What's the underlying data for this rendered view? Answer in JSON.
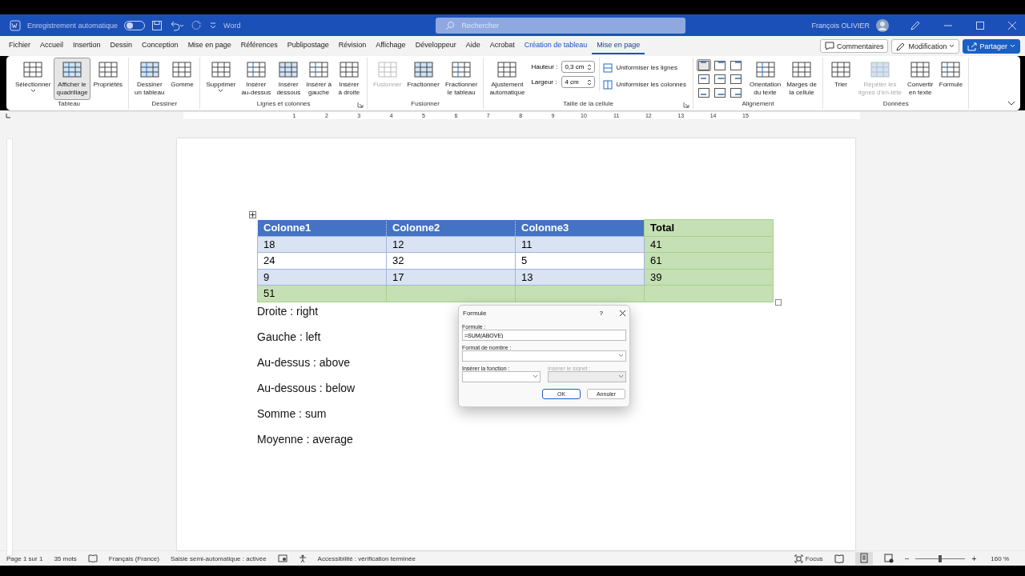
{
  "title_bar": {
    "autosave_label": "Enregistrement automatique",
    "autosave_on": false,
    "app_name": "Word",
    "search_placeholder": "Rechercher",
    "user_name": "François OLIVIER"
  },
  "tabs": [
    {
      "label": "Fichier",
      "kind": "normal",
      "selected": false
    },
    {
      "label": "Accueil",
      "kind": "normal",
      "selected": false
    },
    {
      "label": "Insertion",
      "kind": "normal",
      "selected": false
    },
    {
      "label": "Dessin",
      "kind": "normal",
      "selected": false
    },
    {
      "label": "Conception",
      "kind": "normal",
      "selected": false
    },
    {
      "label": "Mise en page",
      "kind": "normal",
      "selected": false
    },
    {
      "label": "Références",
      "kind": "normal",
      "selected": false
    },
    {
      "label": "Publipostage",
      "kind": "normal",
      "selected": false
    },
    {
      "label": "Révision",
      "kind": "normal",
      "selected": false
    },
    {
      "label": "Affichage",
      "kind": "normal",
      "selected": false
    },
    {
      "label": "Développeur",
      "kind": "normal",
      "selected": false
    },
    {
      "label": "Aide",
      "kind": "normal",
      "selected": false
    },
    {
      "label": "Acrobat",
      "kind": "normal",
      "selected": false
    },
    {
      "label": "Création de tableau",
      "kind": "contextual",
      "selected": false
    },
    {
      "label": "Mise en page",
      "kind": "contextual",
      "selected": true
    }
  ],
  "tab_buttons": {
    "comments": "Commentaires",
    "editing": "Modification",
    "share": "Partager"
  },
  "ribbon": [
    {
      "label": "Tableau",
      "kind": "buttons",
      "items": [
        {
          "lines": [
            "Sélectionner"
          ],
          "dropdown": true,
          "disabled": false,
          "selected": false
        },
        {
          "lines": [
            "Afficher le",
            "quadrillage"
          ],
          "dropdown": false,
          "disabled": false,
          "selected": true
        },
        {
          "lines": [
            "Propriétés"
          ],
          "dropdown": false,
          "disabled": false,
          "selected": false
        }
      ]
    },
    {
      "label": "Dessiner",
      "kind": "buttons",
      "items": [
        {
          "lines": [
            "Dessiner",
            "un tableau"
          ],
          "dropdown": false,
          "disabled": false,
          "selected": false
        },
        {
          "lines": [
            "Gomme"
          ],
          "dropdown": false,
          "disabled": false,
          "selected": false
        }
      ]
    },
    {
      "label": "Lignes et colonnes",
      "kind": "buttons",
      "launcher": true,
      "items": [
        {
          "lines": [
            "Supprimer"
          ],
          "dropdown": true,
          "disabled": false,
          "selected": false
        },
        {
          "lines": [
            "Insérer",
            "au-dessus"
          ],
          "dropdown": false,
          "disabled": false,
          "selected": false
        },
        {
          "lines": [
            "Insérer",
            "dessous"
          ],
          "dropdown": false,
          "disabled": false,
          "selected": false
        },
        {
          "lines": [
            "Insérer à",
            "gauche"
          ],
          "dropdown": false,
          "disabled": false,
          "selected": false
        },
        {
          "lines": [
            "Insérer",
            "à droite"
          ],
          "dropdown": false,
          "disabled": false,
          "selected": false
        }
      ]
    },
    {
      "label": "Fusionner",
      "kind": "buttons",
      "items": [
        {
          "lines": [
            "Fusionner"
          ],
          "dropdown": false,
          "disabled": true,
          "selected": false
        },
        {
          "lines": [
            "Fractionner"
          ],
          "dropdown": false,
          "disabled": false,
          "selected": false
        },
        {
          "lines": [
            "Fractionner",
            "le tableau"
          ],
          "dropdown": false,
          "disabled": false,
          "selected": false
        }
      ]
    },
    {
      "label": "Taille de la cellule",
      "kind": "cell_size",
      "launcher": true,
      "auto_fit": {
        "lines": [
          "Ajustement",
          "automatique"
        ]
      },
      "height_label": "Hauteur :",
      "height_value": "0,3 cm",
      "width_label": "Largeur :",
      "width_value": "4 cm",
      "distribute_rows": "Uniformiser les lignes",
      "distribute_columns": "Uniformiser les colonnes"
    },
    {
      "label": "Alignement",
      "kind": "alignment",
      "align_buttons": [
        {
          "selected": true
        },
        {
          "selected": false
        },
        {
          "selected": false
        },
        {
          "selected": false
        },
        {
          "selected": false
        },
        {
          "selected": false
        },
        {
          "selected": false
        },
        {
          "selected": false
        },
        {
          "selected": false
        }
      ],
      "items": [
        {
          "lines": [
            "Orientation",
            "du texte"
          ],
          "dropdown": false,
          "disabled": false,
          "selected": false
        },
        {
          "lines": [
            "Marges de",
            "la cellule"
          ],
          "dropdown": false,
          "disabled": false,
          "selected": false
        }
      ]
    },
    {
      "label": "Données",
      "kind": "buttons",
      "items": [
        {
          "lines": [
            "Trier"
          ],
          "dropdown": false,
          "disabled": false,
          "selected": false
        },
        {
          "lines": [
            "Répéter les",
            "lignes d'en-tête"
          ],
          "dropdown": false,
          "disabled": true,
          "selected": false
        },
        {
          "lines": [
            "Convertir",
            "en texte"
          ],
          "dropdown": false,
          "disabled": false,
          "selected": false
        },
        {
          "lines": [
            "Formule"
          ],
          "dropdown": false,
          "disabled": false,
          "selected": false
        }
      ]
    }
  ],
  "ruler_numbers": [
    "1",
    "2",
    "3",
    "4",
    "5",
    "6",
    "7",
    "8",
    "9",
    "10",
    "11",
    "12",
    "13",
    "14",
    "15"
  ],
  "table": {
    "columns": [
      "Colonne1",
      "Colonne2",
      "Colonne3",
      "Total"
    ],
    "rows": [
      [
        "18",
        "12",
        "11",
        "41"
      ],
      [
        "24",
        "32",
        "5",
        "61"
      ],
      [
        "9",
        "17",
        "13",
        "39"
      ],
      [
        "51",
        "",
        "",
        ""
      ]
    ]
  },
  "paragraphs": [
    "Droite : right",
    "Gauche : left",
    "Au-dessus : above",
    "Au-dessous : below",
    "Somme : sum",
    "Moyenne : average"
  ],
  "dialog": {
    "title": "Formule",
    "help": "?",
    "formula_label": "Formule :",
    "formula_value": "=SUM(ABOVE)",
    "number_format_label": "Format de nombre :",
    "function_label": "Insérer la fonction :",
    "bookmark_label": "Insérer le signet :",
    "bookmark_disabled": true,
    "ok": "OK",
    "cancel": "Annuler"
  },
  "status_bar": {
    "left": [
      "Page 1 sur 1",
      "35 mots",
      "Français (France)",
      "Saisie semi-automatique : activée",
      "Accessibilité : vérification terminée"
    ],
    "focus": "Focus",
    "zoom_out": "−",
    "zoom_in": "+",
    "zoom_level": {
      "level": 0.5
    },
    "zoom": "160 %"
  }
}
